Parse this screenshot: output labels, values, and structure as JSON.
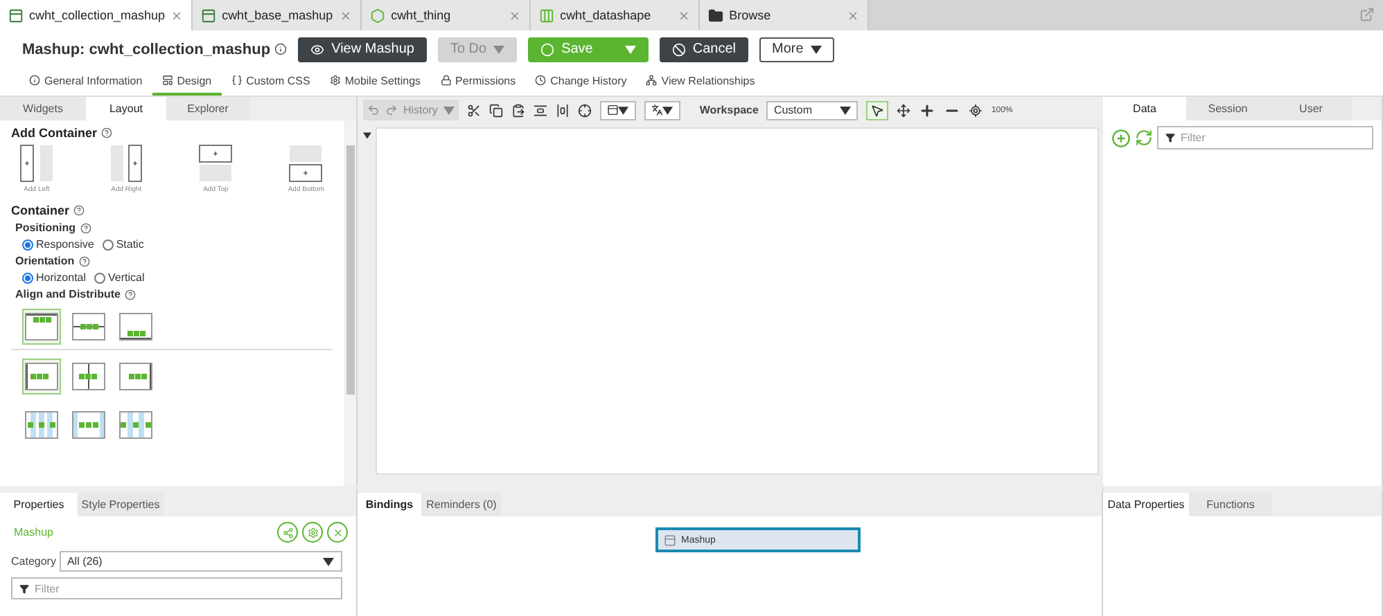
{
  "doc_tabs": [
    {
      "label": "cwht_collection_mashup",
      "kind": "mashup",
      "selected": true
    },
    {
      "label": "cwht_base_mashup",
      "kind": "mashup",
      "selected": false
    },
    {
      "label": "cwht_thing",
      "kind": "thing",
      "selected": false
    },
    {
      "label": "cwht_datashape",
      "kind": "datashape",
      "selected": false
    },
    {
      "label": "Browse",
      "kind": "folder",
      "selected": false
    }
  ],
  "header": {
    "title": "Mashup: cwht_collection_mashup",
    "buttons": [
      {
        "label": "View Mashup",
        "kind": "view"
      },
      {
        "label": "To Do",
        "kind": "todo"
      },
      {
        "label": "Save",
        "kind": "save"
      },
      {
        "label": "Cancel",
        "kind": "cancel"
      },
      {
        "label": "More",
        "kind": "more"
      }
    ]
  },
  "nav_tabs": [
    {
      "label": "General Information",
      "kind": "info",
      "selected": false
    },
    {
      "label": "Design",
      "kind": "design",
      "selected": true
    },
    {
      "label": "Custom CSS",
      "kind": "css",
      "selected": false
    },
    {
      "label": "Mobile Settings",
      "kind": "gear",
      "selected": false
    },
    {
      "label": "Permissions",
      "kind": "lock",
      "selected": false
    },
    {
      "label": "Change History",
      "kind": "clock",
      "selected": false
    },
    {
      "label": "View Relationships",
      "kind": "tree",
      "selected": false
    }
  ],
  "left_tabs": [
    {
      "label": "Widgets",
      "selected": false
    },
    {
      "label": "Layout",
      "selected": true
    },
    {
      "label": "Explorer",
      "selected": false
    }
  ],
  "add_container": {
    "title": "Add Container",
    "options": [
      {
        "label": "Add Left",
        "kind": "left"
      },
      {
        "label": "Add Right",
        "kind": "right"
      },
      {
        "label": "Add Top",
        "kind": "top"
      },
      {
        "label": "Add Bottom",
        "kind": "bottom"
      }
    ]
  },
  "container": {
    "title": "Container",
    "groups": [
      {
        "title": "Positioning",
        "options": [
          {
            "label": "Responsive",
            "selected": true
          },
          {
            "label": "Static",
            "selected": false
          }
        ]
      },
      {
        "title": "Orientation",
        "options": [
          {
            "label": "Horizontal",
            "selected": true
          },
          {
            "label": "Vertical",
            "selected": false
          }
        ]
      }
    ],
    "align_title": "Align and Distribute",
    "align_rows": [
      [
        {
          "kind": "top",
          "selected": true
        },
        {
          "kind": "middle",
          "selected": false
        },
        {
          "kind": "bottom",
          "selected": false
        }
      ],
      [
        {
          "kind": "left",
          "selected": true
        },
        {
          "kind": "center",
          "selected": false
        },
        {
          "kind": "right",
          "selected": false
        }
      ],
      [
        {
          "kind": "around",
          "selected": false
        },
        {
          "kind": "even",
          "selected": false
        },
        {
          "kind": "between",
          "selected": false
        }
      ]
    ]
  },
  "toolbar": {
    "history": "History",
    "workspace_label": "Workspace",
    "workspace_value": "Custom",
    "zoom": "100%"
  },
  "right_tabs": [
    {
      "label": "Data",
      "selected": true
    },
    {
      "label": "Session",
      "selected": false
    },
    {
      "label": "User",
      "selected": false
    }
  ],
  "data_filter": {
    "placeholder": "Filter"
  },
  "properties": {
    "tabs": [
      {
        "label": "Properties",
        "selected": true
      },
      {
        "label": "Style Properties",
        "selected": false
      }
    ],
    "widget": "Mashup",
    "category_label": "Category",
    "category_value": "All (26)",
    "filter_placeholder": "Filter"
  },
  "bindings": {
    "tabs": [
      {
        "label": "Bindings",
        "selected": true
      },
      {
        "label": "Reminders (0)",
        "selected": false
      }
    ],
    "widget": "Mashup"
  },
  "data_properties": {
    "tabs": [
      {
        "label": "Data Properties",
        "selected": true
      },
      {
        "label": "Functions",
        "selected": false
      }
    ]
  }
}
